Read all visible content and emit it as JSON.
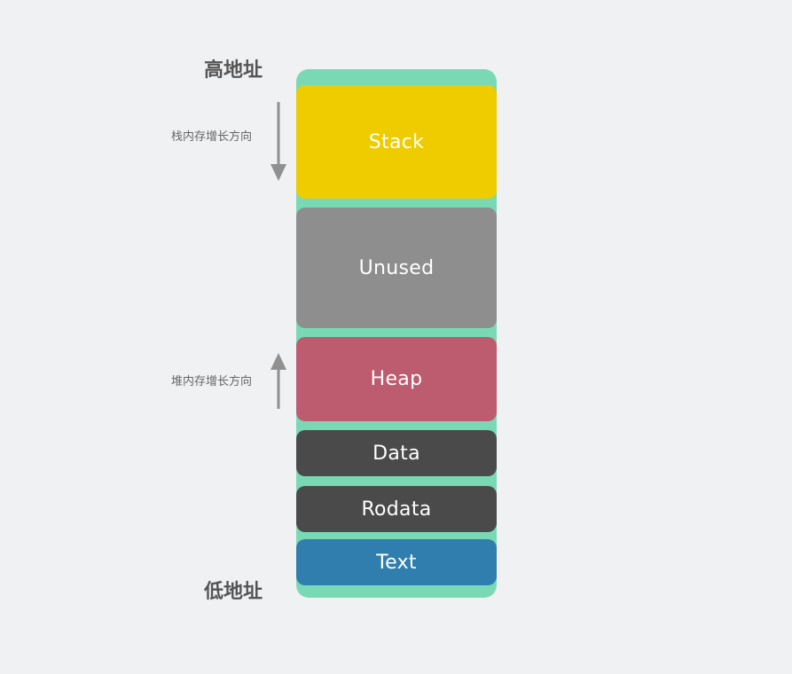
{
  "labels": {
    "high_address": "高地址",
    "low_address": "低地址",
    "stack_growth": "栈内存增长方向",
    "heap_growth": "堆内存增长方向"
  },
  "segments": [
    {
      "name": "Stack",
      "color": "#eecc00"
    },
    {
      "name": "Unused",
      "color": "#8e8e8e"
    },
    {
      "name": "Heap",
      "color": "#bc5c6e"
    },
    {
      "name": "Data",
      "color": "#4a4a4a"
    },
    {
      "name": "Rodata",
      "color": "#4a4a4a"
    },
    {
      "name": "Text",
      "color": "#2f7ead"
    }
  ],
  "colors": {
    "column_background": "#7ad9b5",
    "page_background": "#f0f1f3",
    "arrow": "#909090"
  },
  "arrows": {
    "stack": "down",
    "heap": "up"
  }
}
